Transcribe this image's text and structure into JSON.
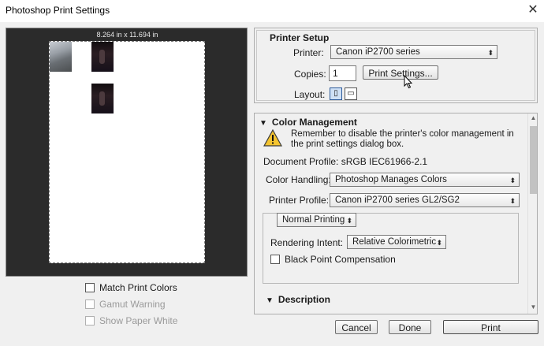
{
  "window": {
    "title": "Photoshop Print Settings",
    "close_label": "✕"
  },
  "preview": {
    "paper_size": "8.264 in x 11.694 in",
    "options": [
      {
        "label": "Match Print Colors",
        "checked": false,
        "enabled": true
      },
      {
        "label": "Gamut Warning",
        "checked": false,
        "enabled": false
      },
      {
        "label": "Show Paper White",
        "checked": false,
        "enabled": false
      }
    ]
  },
  "printer_setup": {
    "title": "Printer Setup",
    "printer_label": "Printer:",
    "printer_value": "Canon iP2700 series",
    "copies_label": "Copies:",
    "copies_value": "1",
    "print_settings_button": "Print Settings...",
    "layout_label": "Layout:"
  },
  "color_management": {
    "title": "Color Management",
    "warning_text": "Remember to disable the printer's color management in the print settings dialog box.",
    "document_profile": "Document Profile: sRGB IEC61966-2.1",
    "color_handling_label": "Color Handling:",
    "color_handling_value": "Photoshop Manages Colors",
    "printer_profile_label": "Printer Profile:",
    "printer_profile_value": "Canon iP2700 series GL2/SG2",
    "print_mode_value": "Normal Printing",
    "rendering_intent_label": "Rendering Intent:",
    "rendering_intent_value": "Relative Colorimetric",
    "black_point_label": "Black Point Compensation",
    "black_point_checked": false,
    "description_title": "Description"
  },
  "buttons": {
    "cancel": "Cancel",
    "done": "Done",
    "print": "Print"
  },
  "icons": {
    "warning": "warning-triangle-icon",
    "portrait": "portrait-layout-icon",
    "landscape": "landscape-layout-icon",
    "cursor": "mouse-cursor-icon"
  },
  "colors": {
    "preview_bg": "#2b2b2b",
    "warning_yellow": "#f4c430"
  }
}
